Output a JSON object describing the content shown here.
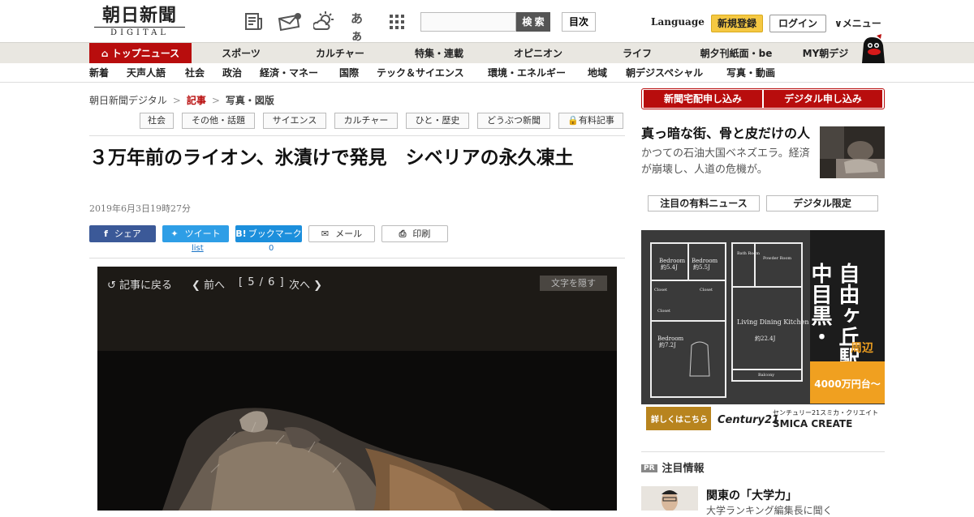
{
  "header": {
    "logo_ja": "朝日新聞",
    "logo_en": "DIGITAL",
    "icons": [
      "newspaper-icon",
      "mail-news-icon",
      "weather-icon",
      "font-size-icon",
      "grid-menu-icon"
    ],
    "font_icon_text": "あぁ",
    "search_button": "検 索",
    "toc_button": "目次",
    "language": "Language",
    "register": "新規登録",
    "login": "ログイン",
    "menu": "メニュー"
  },
  "nav_main": [
    "トップニュース",
    "スポーツ",
    "カルチャー",
    "特集・連載",
    "オピニオン",
    "ライフ",
    "朝夕刊紙面・be",
    "MY朝デジ"
  ],
  "nav_sub": [
    "新着",
    "天声人語",
    "社会",
    "政治",
    "経済・マネー",
    "国際",
    "テック＆サイエンス",
    "環境・エネルギー",
    "地域",
    "朝デジスペシャル",
    "写真・動画"
  ],
  "breadcrumb": [
    "朝日新聞デジタル",
    "記事",
    "写真・図版"
  ],
  "tags": [
    "社会",
    "その他・話題",
    "サイエンス",
    "カルチャー",
    "ひと・歴史",
    "どうぶつ新聞",
    "有料記事"
  ],
  "article": {
    "title": "３万年前のライオン、氷漬けで発見　シベリアの永久凍土",
    "date": "2019年6月3日19時27分"
  },
  "share": {
    "facebook": "シェア",
    "twitter": "ツイート",
    "hatena": "ブックマーク",
    "hatena_icon": "B!",
    "mail": "メール",
    "print": "印刷",
    "twitter_count": "list",
    "hatena_count": "0"
  },
  "viewer": {
    "back": "記事に戻る",
    "prev": "前へ",
    "counter": "[ 5 / 6 ]",
    "next": "次へ",
    "hide_text": "文字を隠す"
  },
  "sidebar": {
    "subscribe_paper": "新聞宅配申し込み",
    "subscribe_digital": "デジタル申し込み",
    "feature_title": "真っ暗な街、骨と皮だけの人",
    "feature_body": "かつての石油大国ベネズエラ。経済が崩壊し、人道の危機が。",
    "tab_paid": "注目の有料ニュース",
    "tab_digital": "デジタル限定",
    "pr_badge": "PR",
    "pr_heading": "注目情報",
    "pr_title": "関東の「大学力」",
    "pr_sub": "大学ランキング編集長に聞く"
  },
  "ad": {
    "station_line1": "中目黒・",
    "station_line2": "自由ヶ丘駅",
    "area": "周辺",
    "price": "4000万円台〜",
    "cta": "詳しくはこちら",
    "brand": "Century21",
    "company_ja": "センチュリー21スミカ・クリエイト",
    "company_en": "SMICA CREATE",
    "rooms": [
      "Bedroom",
      "Bedroom",
      "Bath Room",
      "Powder Room",
      "Closet",
      "Closet",
      "Closet",
      "Living Dining Kitchen",
      "Bedroom",
      "Balcony"
    ],
    "room_sizes": [
      "約5.4J",
      "約5.5J",
      "約22.4J",
      "約7.2J"
    ]
  },
  "colors": {
    "brand_red": "#b80d0d",
    "register_yellow": "#f5c842",
    "facebook": "#3b5998",
    "twitter": "#2e9ee6",
    "hatena": "#1c8fdc",
    "ad_orange": "#f0a020"
  }
}
